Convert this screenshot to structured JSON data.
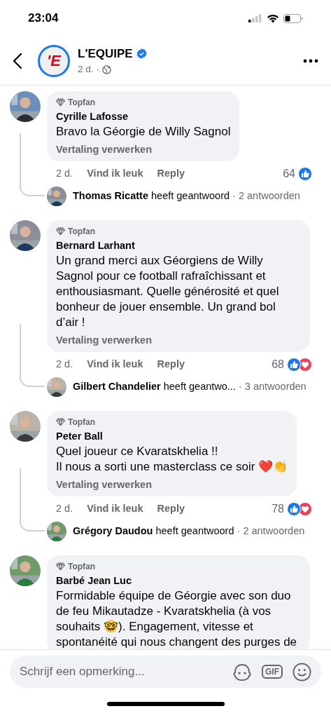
{
  "status_bar": {
    "time": "23:04"
  },
  "header": {
    "page_name": "L'EQUIPE",
    "verified": true,
    "meta": "2 d. ·",
    "logo_text": "'E"
  },
  "comments": [
    {
      "badge": "Topfan",
      "author": "Cyrille Lafosse",
      "text": "Bravo la Géorgie de Willy Sagnol",
      "translate": "Vertaling verwerken",
      "time": "2 d.",
      "like_label": "Vind ik leuk",
      "reply_label": "Reply",
      "count": "64",
      "reactions": [
        {
          "kind": "like"
        }
      ],
      "replies": {
        "author": "Thomas Ricatte",
        "action": "heeft geantwoord",
        "count": "· 2 antwoorden"
      }
    },
    {
      "badge": "Topfan",
      "author": "Bernard Larhant",
      "text": "Un grand merci aux Géorgiens de Willy Sagnol pour ce football rafraîchissant et enthousiasmant. Quelle générosité et quel bonheur de jouer ensemble. Un grand bol d’air !",
      "translate": "Vertaling verwerken",
      "time": "2 d.",
      "like_label": "Vind ik leuk",
      "reply_label": "Reply",
      "count": "68",
      "reactions": [
        {
          "kind": "like"
        },
        {
          "kind": "love"
        }
      ],
      "replies": {
        "author": "Gilbert Chandelier",
        "action": "heeft geantwo...",
        "count": "· 3 antwoorden"
      }
    },
    {
      "badge": "Topfan",
      "author": "Peter Ball",
      "text": "Quel joueur ce Kvaratskhelia !!\nIl nous a sorti une masterclass ce soir ❤️👏",
      "translate": "Vertaling verwerken",
      "time": "2 d.",
      "like_label": "Vind ik leuk",
      "reply_label": "Reply",
      "count": "78",
      "reactions": [
        {
          "kind": "like"
        },
        {
          "kind": "love"
        }
      ],
      "replies": {
        "author": "Grégory Daudou",
        "action": "heeft geantwoord",
        "count": "· 2 antwoorden"
      }
    },
    {
      "badge": "Topfan",
      "author": "Barbé Jean Luc",
      "text": "Formidable équipe de Géorgie avec son duo de feu Mikautadze - Kvaratskhelia (à vos souhaits 🤓). Engagement, vitesse et spontanéité qui nous changent des purges de"
    }
  ],
  "composer": {
    "placeholder": "Schrijf een opmerking...",
    "gif_label": "GIF"
  }
}
